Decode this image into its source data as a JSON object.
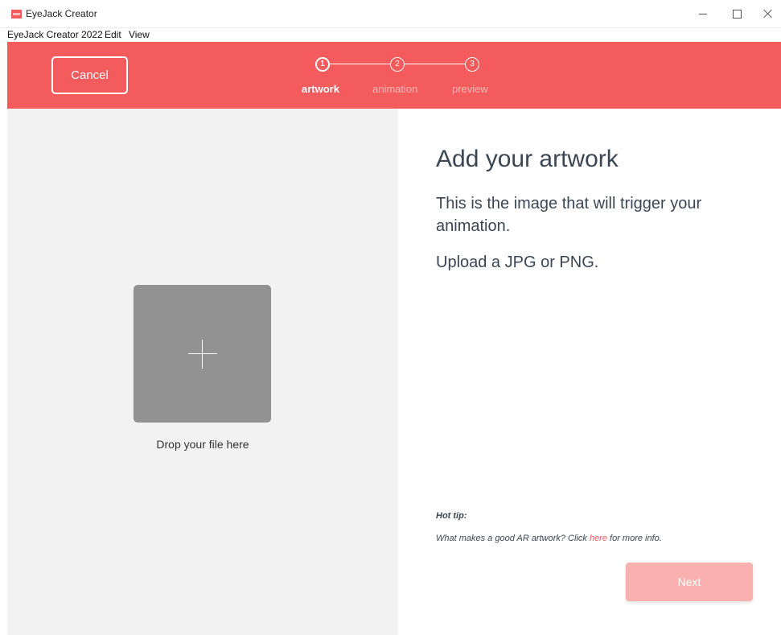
{
  "window": {
    "title": "EyeJack Creator"
  },
  "menu": {
    "items": [
      "EyeJack Creator 2022",
      "Edit",
      "View"
    ]
  },
  "header": {
    "cancel_label": "Cancel",
    "steps": [
      {
        "number": "1",
        "label": "artwork",
        "active": true
      },
      {
        "number": "2",
        "label": "animation",
        "active": false
      },
      {
        "number": "3",
        "label": "preview",
        "active": false
      }
    ]
  },
  "drop_zone": {
    "icon": "plus-icon",
    "text": "Drop your file here"
  },
  "content": {
    "title": "Add your artwork",
    "subtitle": "This is the image that will trigger your animation.",
    "upload_text": "Upload a JPG or PNG.",
    "hot_tip_label": "Hot tip:",
    "hot_tip_before": "What makes a good AR artwork? Click ",
    "hot_tip_link": "here",
    "hot_tip_after": " for more info.",
    "next_label": "Next"
  },
  "colors": {
    "accent": "#f35b5c",
    "next_disabled": "#fbb0b0",
    "left_pane_bg": "#f2f2f2",
    "drop_box": "#929292"
  }
}
